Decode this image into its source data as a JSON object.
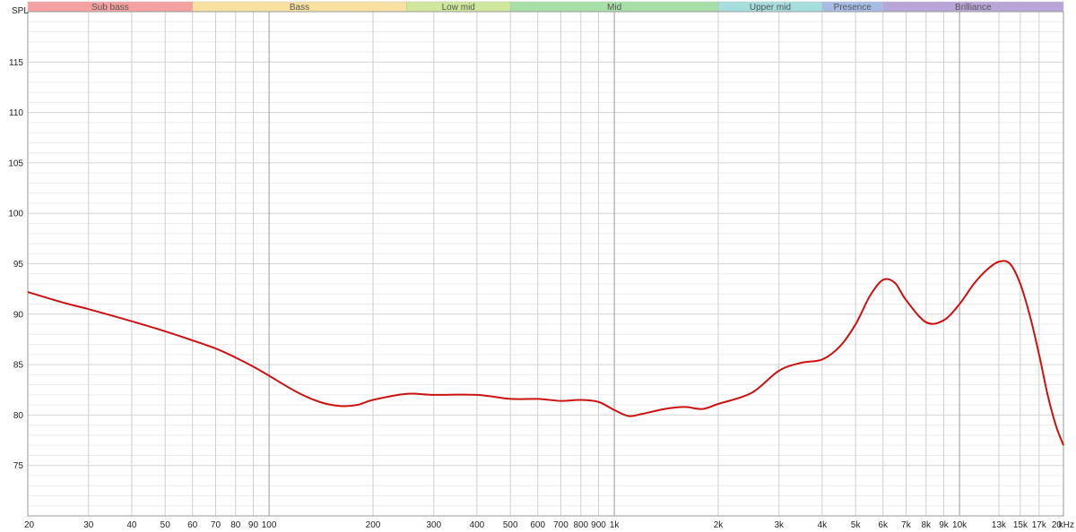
{
  "chart_data": {
    "type": "line",
    "ylabel": "SPL",
    "xunit": "kHz",
    "xscale": "log",
    "xlim": [
      20,
      20000
    ],
    "ylim": [
      70,
      120
    ],
    "grid": true,
    "bands": [
      {
        "label": "Sub bass",
        "from": 20,
        "to": 60,
        "color": "#f6a1a1"
      },
      {
        "label": "Bass",
        "from": 60,
        "to": 250,
        "color": "#f8e0a0"
      },
      {
        "label": "Low mid",
        "from": 250,
        "to": 500,
        "color": "#cfe79a"
      },
      {
        "label": "Mid",
        "from": 500,
        "to": 2000,
        "color": "#a6e0a8"
      },
      {
        "label": "Upper mid",
        "from": 2000,
        "to": 4000,
        "color": "#a6dede"
      },
      {
        "label": "Presence",
        "from": 4000,
        "to": 6000,
        "color": "#a8bde6"
      },
      {
        "label": "Brilliance",
        "from": 6000,
        "to": 20000,
        "color": "#b9a6d8"
      }
    ],
    "y_ticks": [
      {
        "value": 75,
        "label": "75"
      },
      {
        "value": 80,
        "label": "80"
      },
      {
        "value": 85,
        "label": "85"
      },
      {
        "value": 90,
        "label": "90"
      },
      {
        "value": 95,
        "label": "95"
      },
      {
        "value": 100,
        "label": "100"
      },
      {
        "value": 105,
        "label": "105"
      },
      {
        "value": 110,
        "label": "110"
      },
      {
        "value": 115,
        "label": "115"
      }
    ],
    "x_ticks": [
      {
        "value": 20,
        "label": "20"
      },
      {
        "value": 30,
        "label": "30"
      },
      {
        "value": 40,
        "label": "40"
      },
      {
        "value": 50,
        "label": "50"
      },
      {
        "value": 60,
        "label": "60"
      },
      {
        "value": 70,
        "label": "70"
      },
      {
        "value": 80,
        "label": "80"
      },
      {
        "value": 90,
        "label": "90"
      },
      {
        "value": 100,
        "label": "100"
      },
      {
        "value": 200,
        "label": "200"
      },
      {
        "value": 300,
        "label": "300"
      },
      {
        "value": 400,
        "label": "400"
      },
      {
        "value": 500,
        "label": "500"
      },
      {
        "value": 600,
        "label": "600"
      },
      {
        "value": 700,
        "label": "700"
      },
      {
        "value": 800,
        "label": "800"
      },
      {
        "value": 900,
        "label": "900"
      },
      {
        "value": 1000,
        "label": "1k"
      },
      {
        "value": 2000,
        "label": "2k"
      },
      {
        "value": 3000,
        "label": "3k"
      },
      {
        "value": 4000,
        "label": "4k"
      },
      {
        "value": 5000,
        "label": "5k"
      },
      {
        "value": 6000,
        "label": "6k"
      },
      {
        "value": 7000,
        "label": "7k"
      },
      {
        "value": 8000,
        "label": "8k"
      },
      {
        "value": 9000,
        "label": "9k"
      },
      {
        "value": 10000,
        "label": "10k"
      },
      {
        "value": 13000,
        "label": "13k"
      },
      {
        "value": 15000,
        "label": "15k"
      },
      {
        "value": 17000,
        "label": "17k"
      },
      {
        "value": 20000,
        "label": "20"
      }
    ],
    "series": [
      {
        "color": "#cc1111",
        "x": [
          20,
          25,
          30,
          40,
          50,
          60,
          70,
          80,
          90,
          100,
          120,
          140,
          160,
          180,
          200,
          250,
          300,
          400,
          500,
          600,
          700,
          800,
          900,
          1000,
          1100,
          1200,
          1400,
          1600,
          1800,
          2000,
          2500,
          3000,
          3500,
          4000,
          4500,
          5000,
          5500,
          6000,
          6500,
          7000,
          8000,
          9000,
          10000,
          11000,
          12000,
          13000,
          14000,
          15000,
          16000,
          17000,
          18000,
          19000,
          20000
        ],
        "y": [
          92.2,
          91.2,
          90.5,
          89.3,
          88.3,
          87.4,
          86.6,
          85.7,
          84.8,
          83.9,
          82.3,
          81.3,
          80.9,
          81.0,
          81.5,
          82.1,
          82.0,
          82.0,
          81.6,
          81.6,
          81.4,
          81.5,
          81.3,
          80.5,
          79.9,
          80.1,
          80.6,
          80.8,
          80.6,
          81.1,
          82.2,
          84.4,
          85.2,
          85.5,
          86.8,
          89.0,
          91.8,
          93.4,
          93.1,
          91.4,
          89.2,
          89.4,
          91.0,
          93.0,
          94.4,
          95.2,
          95.0,
          93.0,
          89.8,
          86.0,
          82.0,
          79.0,
          77.0
        ]
      }
    ]
  }
}
